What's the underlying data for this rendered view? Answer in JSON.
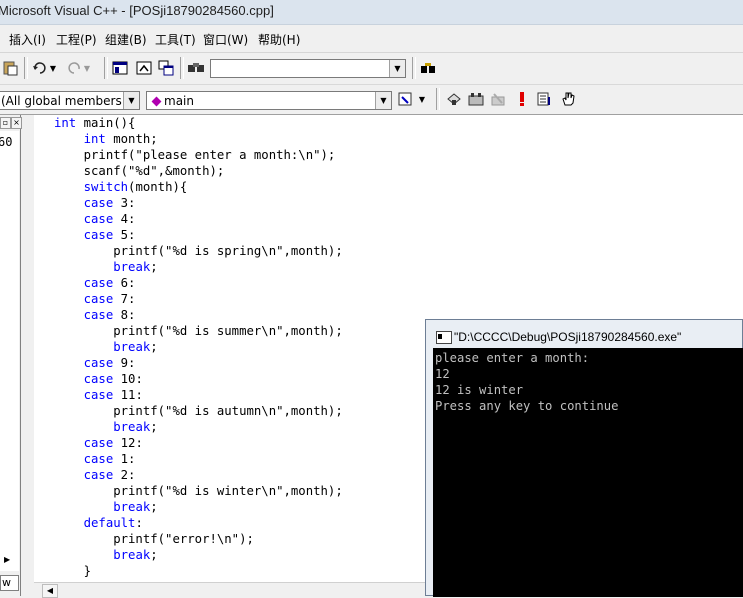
{
  "window": {
    "title": "Microsoft Visual C++ - [POSji18790284560.cpp]"
  },
  "menu": [
    {
      "label": "插入(I)"
    },
    {
      "label": "工程(P)"
    },
    {
      "label": "组建(B)"
    },
    {
      "label": "工具(T)"
    },
    {
      "label": "窗口(W)"
    },
    {
      "label": "帮助(H)"
    }
  ],
  "toolbar": {
    "find_combo_value": ""
  },
  "wizardbar": {
    "scope_combo": "(All global members",
    "member_combo": "main"
  },
  "left_pane": {
    "visible_text": "60",
    "tab_text": "w"
  },
  "editor": {
    "lines": [
      [
        {
          "t": "int",
          "k": 1
        },
        {
          "t": " main(){"
        }
      ],
      [
        {
          "t": "    "
        },
        {
          "t": "int",
          "k": 1
        },
        {
          "t": " month;"
        }
      ],
      [
        {
          "t": "    printf(\"please enter a month:\\n\");"
        }
      ],
      [
        {
          "t": "    scanf(\"%d\",&month);"
        }
      ],
      [
        {
          "t": "    "
        },
        {
          "t": "switch",
          "k": 1
        },
        {
          "t": "(month){"
        }
      ],
      [
        {
          "t": "    "
        },
        {
          "t": "case",
          "k": 1
        },
        {
          "t": " 3:"
        }
      ],
      [
        {
          "t": "    "
        },
        {
          "t": "case",
          "k": 1
        },
        {
          "t": " 4:"
        }
      ],
      [
        {
          "t": "    "
        },
        {
          "t": "case",
          "k": 1
        },
        {
          "t": " 5:"
        }
      ],
      [
        {
          "t": "        printf(\"%d is spring\\n\",month);"
        }
      ],
      [
        {
          "t": "        "
        },
        {
          "t": "break",
          "k": 1
        },
        {
          "t": ";"
        }
      ],
      [
        {
          "t": "    "
        },
        {
          "t": "case",
          "k": 1
        },
        {
          "t": " 6:"
        }
      ],
      [
        {
          "t": "    "
        },
        {
          "t": "case",
          "k": 1
        },
        {
          "t": " 7:"
        }
      ],
      [
        {
          "t": "    "
        },
        {
          "t": "case",
          "k": 1
        },
        {
          "t": " 8:"
        }
      ],
      [
        {
          "t": "        printf(\"%d is summer\\n\",month);"
        }
      ],
      [
        {
          "t": "        "
        },
        {
          "t": "break",
          "k": 1
        },
        {
          "t": ";"
        }
      ],
      [
        {
          "t": "    "
        },
        {
          "t": "case",
          "k": 1
        },
        {
          "t": " 9:"
        }
      ],
      [
        {
          "t": "    "
        },
        {
          "t": "case",
          "k": 1
        },
        {
          "t": " 10:"
        }
      ],
      [
        {
          "t": "    "
        },
        {
          "t": "case",
          "k": 1
        },
        {
          "t": " 11:"
        }
      ],
      [
        {
          "t": "        printf(\"%d is autumn\\n\",month);"
        }
      ],
      [
        {
          "t": "        "
        },
        {
          "t": "break",
          "k": 1
        },
        {
          "t": ";"
        }
      ],
      [
        {
          "t": "    "
        },
        {
          "t": "case",
          "k": 1
        },
        {
          "t": " 12:"
        }
      ],
      [
        {
          "t": "    "
        },
        {
          "t": "case",
          "k": 1
        },
        {
          "t": " 1:"
        }
      ],
      [
        {
          "t": "    "
        },
        {
          "t": "case",
          "k": 1
        },
        {
          "t": " 2:"
        }
      ],
      [
        {
          "t": "        printf(\"%d is winter\\n\",month);"
        }
      ],
      [
        {
          "t": "        "
        },
        {
          "t": "break",
          "k": 1
        },
        {
          "t": ";"
        }
      ],
      [
        {
          "t": "    "
        },
        {
          "t": "default",
          "k": 1
        },
        {
          "t": ":"
        }
      ],
      [
        {
          "t": "        printf(\"error!\\n\");"
        }
      ],
      [
        {
          "t": "        "
        },
        {
          "t": "break",
          "k": 1
        },
        {
          "t": ";"
        }
      ],
      [
        {
          "t": "    }"
        }
      ]
    ],
    "keyword_color": "#0000ff"
  },
  "console": {
    "title": "\"D:\\CCCC\\Debug\\POSji18790284560.exe\"",
    "output": [
      "please enter a month:",
      "12",
      "12 is winter",
      "Press any key to continue"
    ]
  }
}
